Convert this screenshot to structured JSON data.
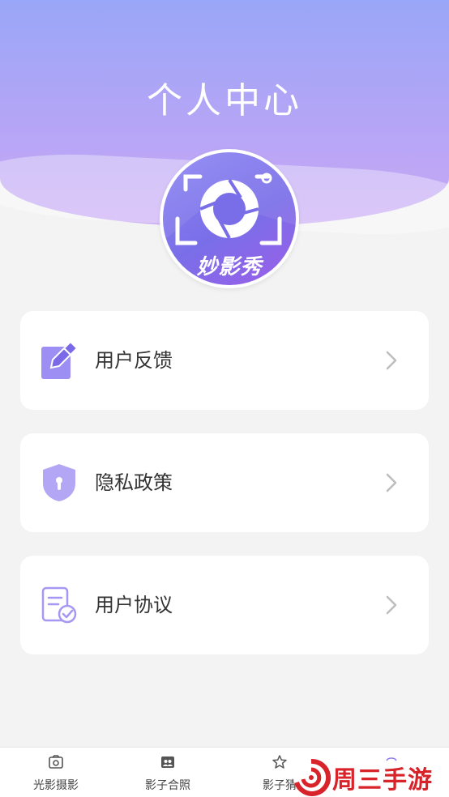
{
  "header": {
    "title": "个人中心"
  },
  "avatar": {
    "brand_text": "妙影秀"
  },
  "menu": {
    "items": [
      {
        "label": "用户反馈",
        "icon": "edit-note-icon"
      },
      {
        "label": "隐私政策",
        "icon": "shield-lock-icon"
      },
      {
        "label": "用户协议",
        "icon": "document-check-icon"
      }
    ]
  },
  "bottom_nav": {
    "items": [
      {
        "label": "光影摄影",
        "icon": "photo-frame-icon"
      },
      {
        "label": "影子合照",
        "icon": "portrait-icon"
      },
      {
        "label": "影子猜",
        "icon": "star-icon"
      },
      {
        "label": "",
        "icon": "profile-icon"
      }
    ]
  },
  "watermark": {
    "text": "周三手游网"
  },
  "colors": {
    "accent": "#8b7cf0",
    "header_top": "#9aa6f7",
    "header_bottom": "#c9a9f4",
    "watermark_red": "#d8232a"
  }
}
